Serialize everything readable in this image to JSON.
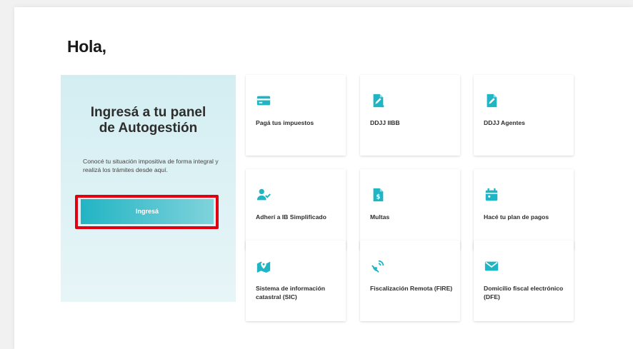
{
  "greeting": "Hola,",
  "panel": {
    "title": "Ingresá a tu panel de Autogestión",
    "description": "Conocé tu situación impositiva de forma integral y realizá los trámites desde aquí.",
    "button_label": "Ingresá"
  },
  "accent_color": "#1fb5c4",
  "highlight_color": "#e00012",
  "cards": [
    {
      "label": "Pagá tus impuestos",
      "icon": "credit-card-icon"
    },
    {
      "label": "DDJJ IIBB",
      "icon": "document-edit-icon"
    },
    {
      "label": "DDJJ Agentes",
      "icon": "document-edit-icon"
    },
    {
      "label": "Adherí a IB Simplificado",
      "icon": "user-check-icon"
    },
    {
      "label": "Multas",
      "icon": "document-dollar-icon"
    },
    {
      "label": "Hacé tu plan de pagos",
      "icon": "calendar-icon"
    },
    {
      "label": "Sistema de información catastral (SIC)",
      "icon": "map-pin-icon"
    },
    {
      "label": "Fiscalización Remota (FIRE)",
      "icon": "satellite-icon"
    },
    {
      "label": "Domicilio fiscal electrónico (DFE)",
      "icon": "envelope-icon"
    }
  ]
}
